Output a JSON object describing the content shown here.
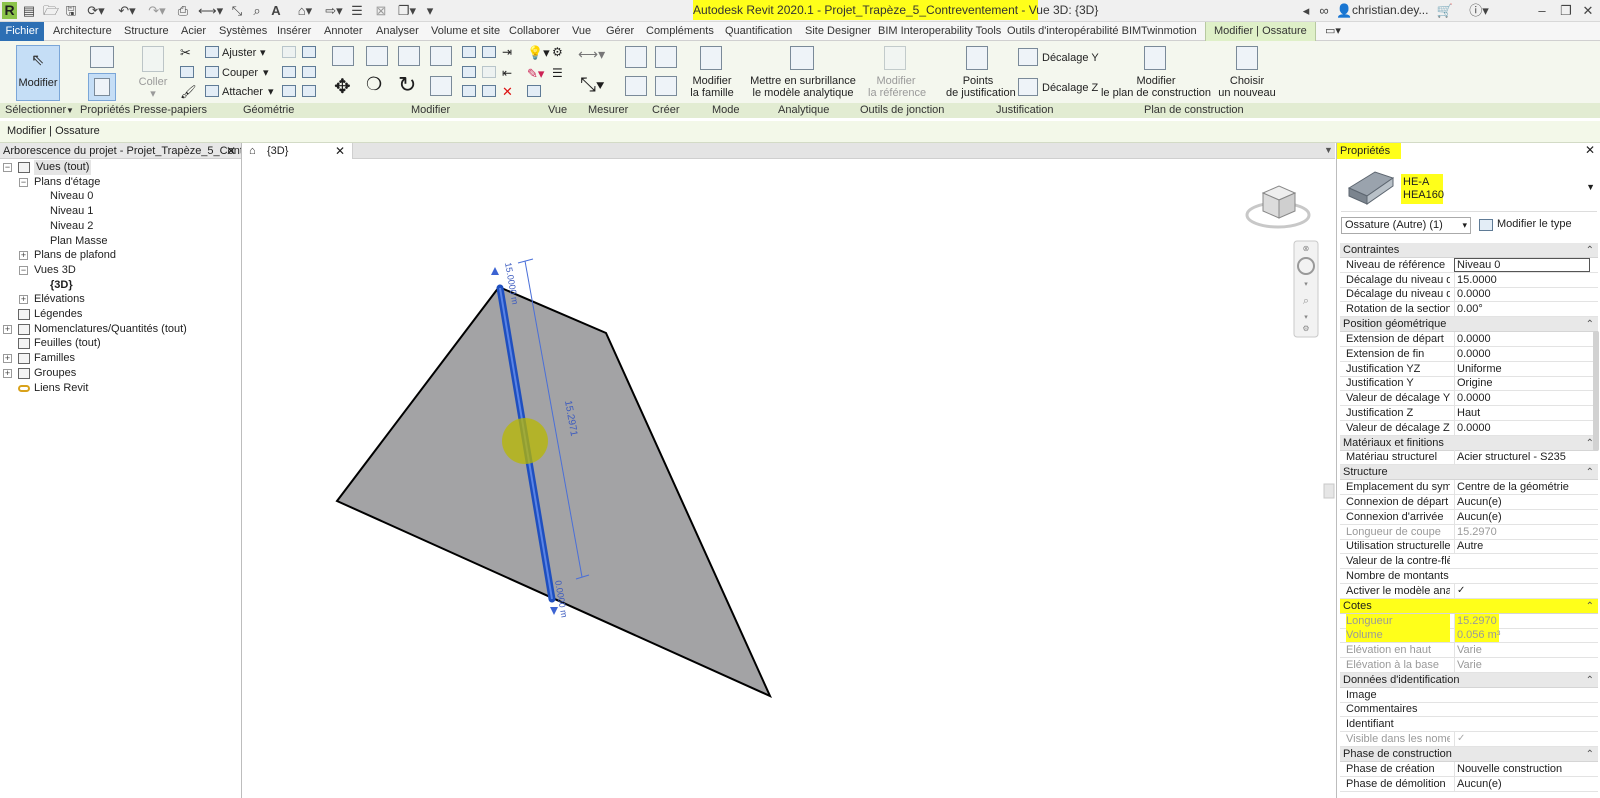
{
  "app": {
    "logo_letter": "R",
    "title": "Autodesk Revit 2020.1 - Projet_Trapèze_5_Contreventement - Vue 3D: {3D}",
    "user": "christian.dey...",
    "quick_access_icons": [
      "open-icon",
      "save-icon",
      "sync-icon",
      "undo-icon",
      "redo-icon",
      "print-icon",
      "measure-icon",
      "dimension-icon",
      "tag-icon",
      "text-icon",
      "3d-view-icon",
      "section-icon",
      "thin-lines-icon",
      "close-hidden-icon",
      "switch-windows-icon"
    ]
  },
  "tabs": [
    {
      "label": "Fichier"
    },
    {
      "label": "Architecture"
    },
    {
      "label": "Structure"
    },
    {
      "label": "Acier"
    },
    {
      "label": "Systèmes"
    },
    {
      "label": "Insérer"
    },
    {
      "label": "Annoter"
    },
    {
      "label": "Analyser"
    },
    {
      "label": "Volume et site"
    },
    {
      "label": "Collaborer"
    },
    {
      "label": "Vue"
    },
    {
      "label": "Gérer"
    },
    {
      "label": "Compléments"
    },
    {
      "label": "Quantification"
    },
    {
      "label": "Site Designer"
    },
    {
      "label": "BIM Interoperability Tools"
    },
    {
      "label": "Outils d'interopérabilité BIM"
    },
    {
      "label": "Twinmotion"
    },
    {
      "label": "Modifier | Ossature"
    }
  ],
  "ribbon": {
    "modifier": "Modifier",
    "coller": "Coller",
    "ajuster": "Ajuster",
    "couper": "Couper",
    "attacher": "Attacher",
    "modifier_famille": [
      "Modifier",
      "la famille"
    ],
    "surbrillance": [
      "Mettre en surbrillance",
      "le modèle analytique"
    ],
    "modifier_reference": [
      "Modifier",
      "la référence"
    ],
    "points_justification": [
      "Points",
      "de justification"
    ],
    "decalage_y": "Décalage Y",
    "decalage_z": "Décalage Z",
    "modifier_plan": [
      "Modifier",
      "le plan de construction"
    ],
    "choisir": [
      "Choisir",
      "un nouveau"
    ],
    "panels": [
      "Sélectionner",
      "Propriétés",
      "Presse-papiers",
      "Géométrie",
      "Modifier",
      "Vue",
      "Mesurer",
      "Créer",
      "Mode",
      "Analytique",
      "Outils de jonction",
      "Justification",
      "Plan de construction"
    ]
  },
  "options_bar": {
    "context": "Modifier | Ossature"
  },
  "browser": {
    "title": "Arborescence du projet - Projet_Trapèze_5_Contr...",
    "items": [
      {
        "label": "Vues (tout)",
        "level": 0,
        "exp": "-",
        "icon": true
      },
      {
        "label": "Plans d'étage",
        "level": 1,
        "exp": "-"
      },
      {
        "label": "Niveau 0",
        "level": 2
      },
      {
        "label": "Niveau 1",
        "level": 2
      },
      {
        "label": "Niveau 2",
        "level": 2
      },
      {
        "label": "Plan Masse",
        "level": 2
      },
      {
        "label": "Plans de plafond",
        "level": 1,
        "exp": "+"
      },
      {
        "label": "Vues 3D",
        "level": 1,
        "exp": "-"
      },
      {
        "label": "{3D}",
        "level": 2,
        "bold": true
      },
      {
        "label": "Elévations",
        "level": 1,
        "exp": "+"
      },
      {
        "label": "Légendes",
        "level": 0,
        "icon": true
      },
      {
        "label": "Nomenclatures/Quantités (tout)",
        "level": 0,
        "exp": "+",
        "icon": true
      },
      {
        "label": "Feuilles (tout)",
        "level": 0,
        "icon": true
      },
      {
        "label": "Familles",
        "level": 0,
        "exp": "+",
        "icon": true
      },
      {
        "label": "Groupes",
        "level": 0,
        "exp": "+",
        "icon": true
      },
      {
        "label": "Liens Revit",
        "level": 0,
        "icon": true,
        "link": true
      }
    ]
  },
  "view": {
    "tab_label": "{3D}",
    "dim_top": "15.0000 m",
    "dim_length": "15.2971",
    "dim_bottom": "0.0000 m"
  },
  "properties": {
    "title": "Propriétés",
    "type_family": "HE-A",
    "type_name": "HEA160",
    "filter": "Ossature (Autre) (1)",
    "edit_type": "Modifier le type",
    "rows": [
      {
        "section": "Contraintes"
      },
      {
        "name": "Niveau de référence",
        "value": "Niveau 0",
        "boxed": true
      },
      {
        "name": "Décalage du niveau d...",
        "value": "15.0000"
      },
      {
        "name": "Décalage du niveau d'...",
        "value": "0.0000"
      },
      {
        "name": "Rotation de la section",
        "value": "0.00°"
      },
      {
        "section": "Position géométrique"
      },
      {
        "name": "Extension de départ",
        "value": "0.0000"
      },
      {
        "name": "Extension de fin",
        "value": "0.0000"
      },
      {
        "name": "Justification YZ",
        "value": "Uniforme"
      },
      {
        "name": "Justification Y",
        "value": "Origine"
      },
      {
        "name": "Valeur de décalage Y",
        "value": "0.0000"
      },
      {
        "name": "Justification Z",
        "value": "Haut"
      },
      {
        "name": "Valeur de décalage Z",
        "value": "0.0000"
      },
      {
        "section": "Matériaux et finitions"
      },
      {
        "name": "Matériau structurel",
        "value": "Acier structurel - S235"
      },
      {
        "section": "Structure"
      },
      {
        "name": "Emplacement du sym...",
        "value": "Centre de la géométrie"
      },
      {
        "name": "Connexion de départ",
        "value": "Aucun(e)"
      },
      {
        "name": "Connexion d'arrivée",
        "value": "Aucun(e)"
      },
      {
        "name": "Longueur de coupe",
        "value": "15.2970",
        "ro": true
      },
      {
        "name": "Utilisation structurelle",
        "value": "Autre"
      },
      {
        "name": "Valeur de la contre-flè...",
        "value": ""
      },
      {
        "name": "Nombre de montants",
        "value": ""
      },
      {
        "name": "Activer le modèle ana...",
        "value": "✓",
        "check": true
      },
      {
        "section": "Cotes",
        "hl": true
      },
      {
        "name": "Longueur",
        "value": "15.2970",
        "ro": true,
        "hl": true
      },
      {
        "name": "Volume",
        "value": "0.056 m³",
        "ro": true,
        "hl": true
      },
      {
        "name": "Elévation en haut",
        "value": "Varie",
        "ro": true
      },
      {
        "name": "Elévation à la base",
        "value": "Varie",
        "ro": true
      },
      {
        "section": "Données d'identification"
      },
      {
        "name": "Image",
        "value": ""
      },
      {
        "name": "Commentaires",
        "value": ""
      },
      {
        "name": "Identifiant",
        "value": ""
      },
      {
        "name": "Visible dans les nome...",
        "value": "✓",
        "check": true,
        "ro": true
      },
      {
        "section": "Phase de construction"
      },
      {
        "name": "Phase de création",
        "value": "Nouvelle construction"
      },
      {
        "name": "Phase de démolition",
        "value": "Aucun(e)"
      }
    ]
  },
  "colors": {
    "accent": "#2d6fb4",
    "highlight": "#ffff1a",
    "beam": "#1f4fbf",
    "surface": "#a3a3a5",
    "context_tab": "#dff0c8"
  }
}
